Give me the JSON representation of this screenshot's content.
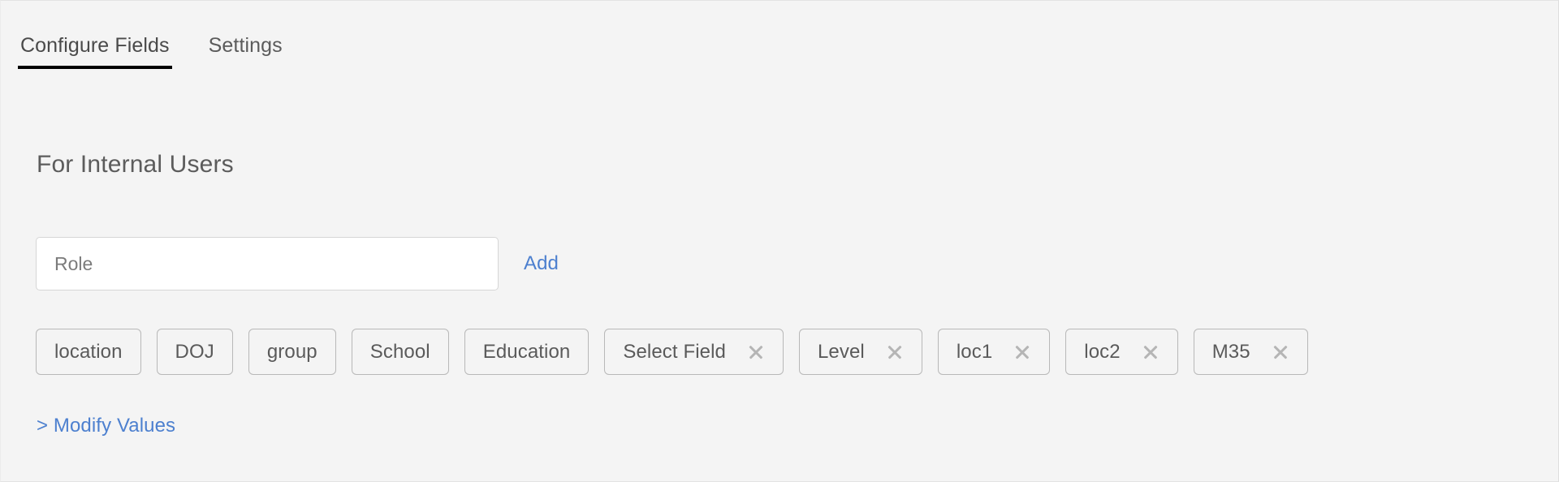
{
  "tabs": [
    {
      "label": "Configure Fields",
      "active": true
    },
    {
      "label": "Settings",
      "active": false
    }
  ],
  "section": {
    "title": "For Internal Users"
  },
  "form": {
    "role_input_value": "",
    "role_input_placeholder": "Role",
    "add_label": "Add"
  },
  "chips": [
    {
      "label": "location",
      "removable": false
    },
    {
      "label": "DOJ",
      "removable": false
    },
    {
      "label": "group",
      "removable": false
    },
    {
      "label": "School",
      "removable": false
    },
    {
      "label": "Education",
      "removable": false
    },
    {
      "label": "Select Field",
      "removable": true
    },
    {
      "label": "Level",
      "removable": true
    },
    {
      "label": "loc1",
      "removable": true
    },
    {
      "label": "loc2",
      "removable": true
    },
    {
      "label": "M35",
      "removable": true
    }
  ],
  "footer": {
    "modify_values_label": "> Modify Values"
  },
  "colors": {
    "panel_background": "#f4f4f4",
    "link": "#4d80cf",
    "active_tab_underline": "#000000",
    "chip_border": "#b8b8b8",
    "input_border": "#d6d6d6",
    "text": "#5a5a5a"
  }
}
